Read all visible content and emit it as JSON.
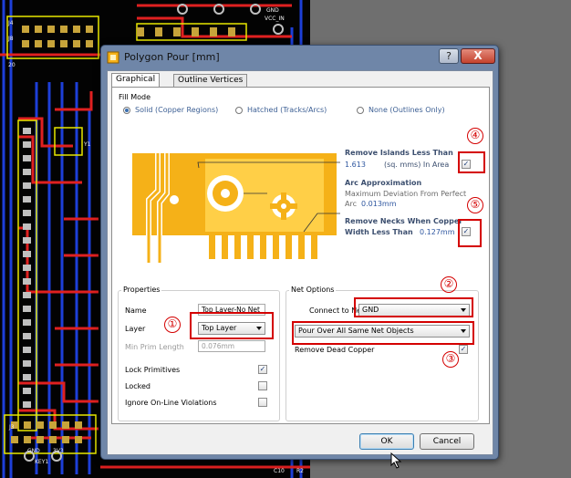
{
  "dialog": {
    "title": "Polygon Pour [mm]",
    "help_label": "?",
    "close_label": "X"
  },
  "tabs": [
    {
      "label": "Graphical",
      "active": true
    },
    {
      "label": "Outline Vertices",
      "active": false
    }
  ],
  "fill_mode": {
    "title": "Fill Mode",
    "options": [
      {
        "label": "Solid (Copper Regions)",
        "selected": true
      },
      {
        "label": "Hatched (Tracks/Arcs)",
        "selected": false
      },
      {
        "label": "None (Outlines Only)",
        "selected": false
      }
    ]
  },
  "preview": {
    "remove_islands": {
      "label": "Remove Islands Less Than",
      "value": "1.613",
      "unit": "(sq. mms) In Area",
      "checked": true
    },
    "arc_approx": {
      "label": "Arc Approximation",
      "sub": "Maximum Deviation From Perfect",
      "sub2_prefix": "Arc",
      "value": "0.013mm"
    },
    "remove_necks": {
      "label": "Remove Necks When Copper",
      "sub": "Width Less Than",
      "value": "0.127mm",
      "checked": true
    }
  },
  "properties": {
    "title": "Properties",
    "name_label": "Name",
    "name_value": "Top Layer-No Net",
    "layer_label": "Layer",
    "layer_value": "Top Layer",
    "min_prim_label": "Min Prim Length",
    "min_prim_value": "0.076mm",
    "lock_primitives_label": "Lock Primitives",
    "lock_primitives_checked": true,
    "locked_label": "Locked",
    "locked_checked": false,
    "ignore_violations_label": "Ignore On-Line Violations",
    "ignore_violations_checked": false
  },
  "net_options": {
    "title": "Net Options",
    "connect_label": "Connect to Net",
    "connect_value": "GND",
    "pour_value": "Pour Over All Same Net Objects",
    "remove_dead_label": "Remove Dead Copper",
    "remove_dead_checked": true
  },
  "callouts": [
    "①",
    "②",
    "③",
    "④",
    "⑤"
  ],
  "buttons": {
    "ok": "OK",
    "cancel": "Cancel"
  },
  "pcb_labels": {
    "j4": "J4",
    "j8": "J8",
    "j3": "J3",
    "r20": "20",
    "vcc_in": "VCC_IN",
    "gnd": "GND",
    "key1": "KEY1",
    "gnd_left": "GND",
    "g3v3": "3V3",
    "c10": "C10",
    "r2": "R2",
    "y1": "Y1"
  },
  "colors": {
    "copper": "#f5b118",
    "track_red": "#e02020",
    "silk": "#e8e800",
    "board_bg": "#030303",
    "accent_blue": "#2f57a0",
    "callout_red": "#d40000"
  }
}
